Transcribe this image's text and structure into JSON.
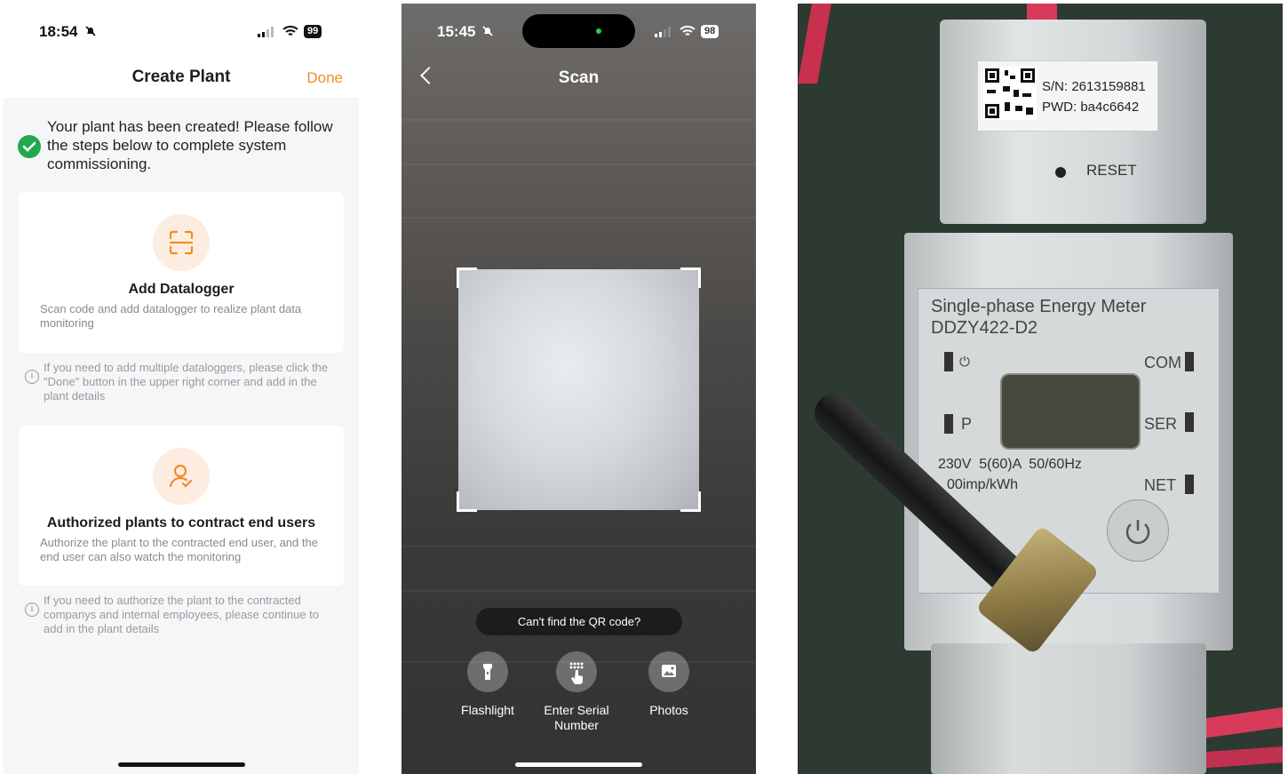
{
  "panel1": {
    "status_time": "18:54",
    "battery": "99",
    "title": "Create Plant",
    "done_label": "Done",
    "success_message": "Your plant has been created! Please follow the steps below to complete system commissioning.",
    "cards": [
      {
        "title": "Add Datalogger",
        "description": "Scan code and add datalogger to realize plant data monitoring",
        "note": "If you need to add multiple dataloggers, please click the \"Done\" button in the upper right corner and add in the plant details"
      },
      {
        "title": "Authorized plants to contract end users",
        "description": "Authorize the plant to the contracted end user, and the end user can also watch the monitoring",
        "note": "If you need to authorize the plant to the contracted companys and internal employees, please continue to add in the plant details"
      }
    ],
    "colors": {
      "accent": "#f08c28",
      "success": "#21a84a",
      "icon_bg": "#fdece0"
    }
  },
  "panel2": {
    "status_time": "15:45",
    "battery": "98",
    "title": "Scan",
    "cant_find_label": "Can't find the QR code?",
    "actions": [
      {
        "label": "Flashlight",
        "icon": "flashlight-icon"
      },
      {
        "label": "Enter Serial Number",
        "icon": "keypad-hand-icon"
      },
      {
        "label": "Photos",
        "icon": "photos-icon"
      }
    ]
  },
  "panel3": {
    "label_sn": "S/N: 2613159881",
    "label_pwd": "PWD: ba4c6642",
    "reset_label": "RESET",
    "meter_title_1": "Single-phase Energy Meter",
    "meter_title_2": "DDZY422-D2",
    "com_label": "COM",
    "ser_label": "SER",
    "net_label": "NET",
    "p_label": "P",
    "specs_line_1": "230V  5(60)A  50/60Hz",
    "specs_line_2": "00imp/kWh"
  }
}
